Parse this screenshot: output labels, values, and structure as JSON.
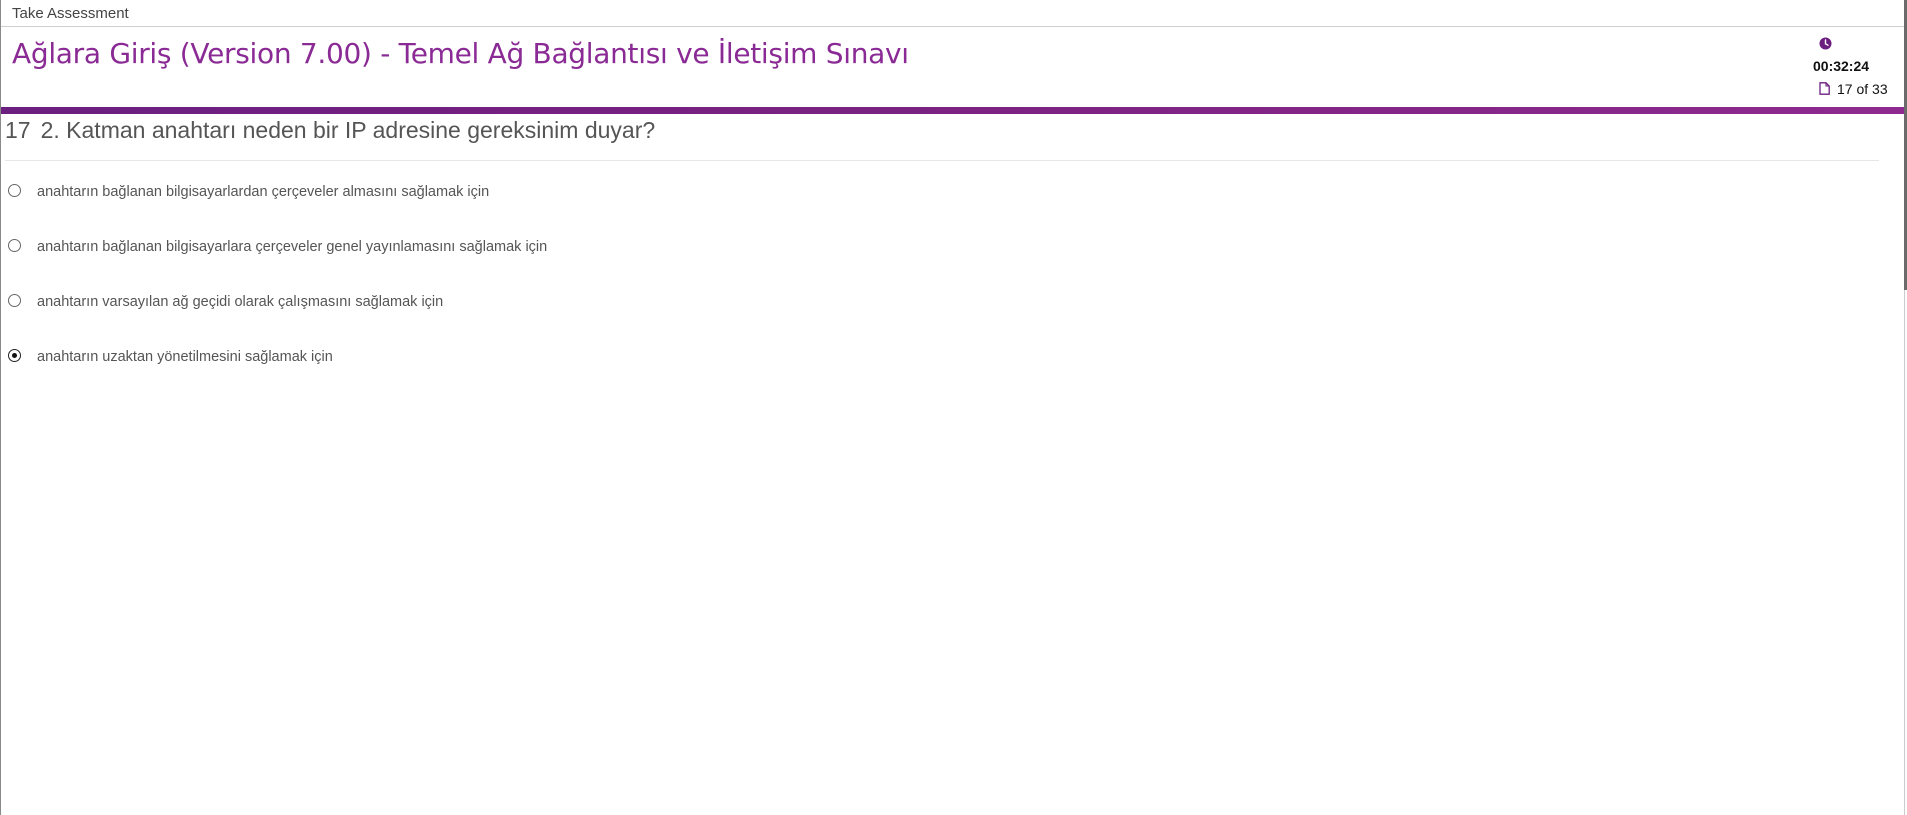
{
  "window": {
    "title": "Take Assessment"
  },
  "header": {
    "exam_title": "Ağlara Giriş (Version 7.00) - Temel Ağ Bağlantısı ve İletişim Sınavı",
    "timer": "00:32:24",
    "progress": "17 of 33",
    "timer_icon": "clock-icon",
    "progress_icon": "page-icon",
    "accent_color": "#7b2282"
  },
  "question": {
    "number": "17",
    "text": "2. Katman anahtarı neden bir IP adresine gereksinim duyar?"
  },
  "options": [
    {
      "label": "anahtarın bağlanan bilgisayarlardan çerçeveler almasını sağlamak için",
      "selected": false
    },
    {
      "label": "anahtarın bağlanan bilgisayarlara çerçeveler genel yayınlamasını sağlamak için",
      "selected": false
    },
    {
      "label": "anahtarın varsayılan ağ geçidi olarak çalışmasını sağlamak için",
      "selected": false
    },
    {
      "label": "anahtarın uzaktan yönetilmesini sağlamak için",
      "selected": true
    }
  ]
}
